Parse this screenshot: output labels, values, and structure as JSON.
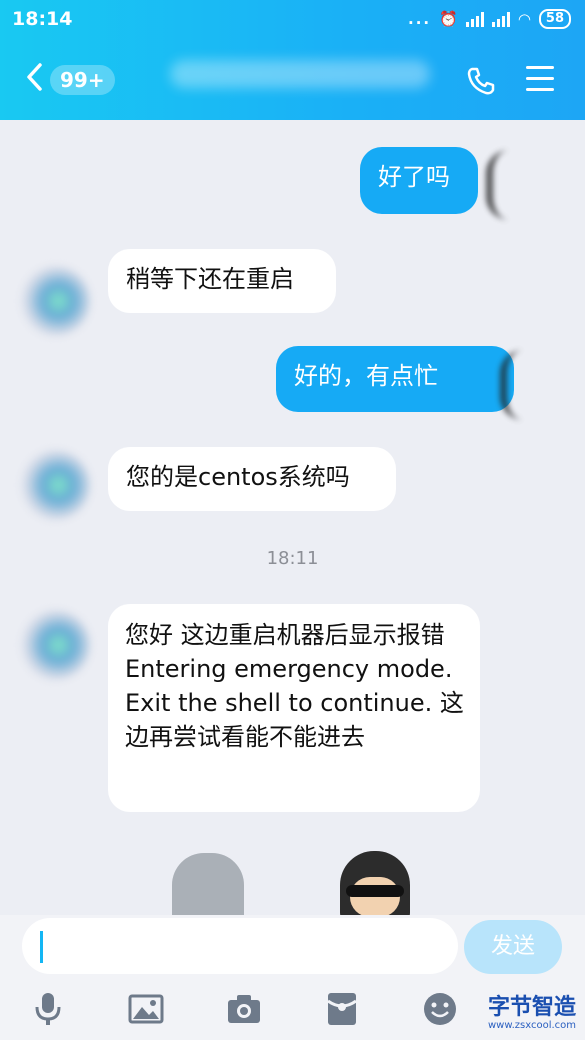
{
  "status": {
    "time": "18:14",
    "dots": "...",
    "battery": "58"
  },
  "header": {
    "unread_badge": "99+"
  },
  "messages": [
    {
      "side": "out",
      "text": "好了吗"
    },
    {
      "side": "in",
      "text": "稍等下还在重启"
    },
    {
      "side": "out",
      "text": "好的，有点忙"
    },
    {
      "side": "in",
      "text": "您的是centos系统吗"
    },
    {
      "side": "in",
      "text": "您好 这边重启机器后显示报错 Entering emergency mode. Exit the shell to continue.  这边再尝试看能不能进去"
    }
  ],
  "timestamp": "18:11",
  "composer": {
    "send_label": "发送",
    "placeholder": ""
  },
  "watermark": {
    "title": "字节智造",
    "url": "www.zsxcool.com"
  },
  "colors": {
    "accent": "#16aaf5",
    "header": "#1ab0f6"
  }
}
